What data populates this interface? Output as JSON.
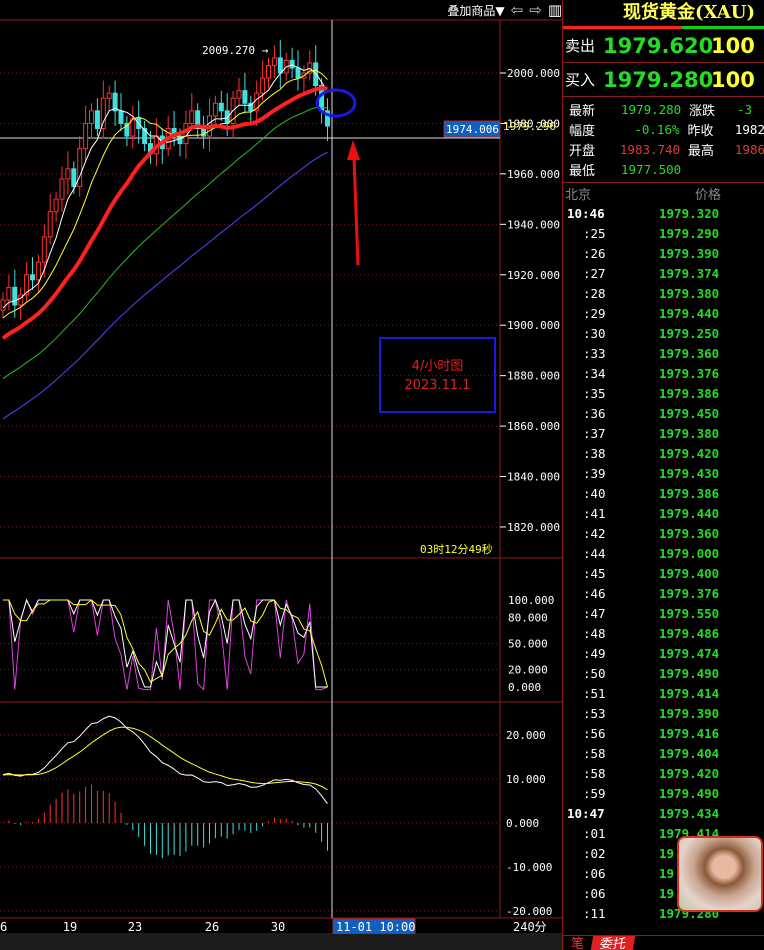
{
  "toolbar": {
    "overlay_label": "叠加商品▼",
    "prev_icon": "⇦",
    "next_icon": "⇨",
    "layout_icon": "▥"
  },
  "instrument": {
    "title": "现货黄金(XAU)"
  },
  "quotes": {
    "sell": {
      "label": "卖出",
      "price": "1979.620",
      "volume": "100"
    },
    "buy": {
      "label": "买入",
      "price": "1979.280",
      "volume": "100"
    }
  },
  "stats": [
    {
      "k": "最新",
      "v": "1979.280",
      "vc": "g1",
      "k2": "涨跌",
      "v2": "-3",
      "v2c": "g1"
    },
    {
      "k": "幅度",
      "v": "-0.16%",
      "vc": "g1",
      "k2": "昨收",
      "v2": "1982",
      "v2c": "wh"
    },
    {
      "k": "开盘",
      "v": "1983.740",
      "vc": "red",
      "k2": "最高",
      "v2": "1986",
      "v2c": "red"
    },
    {
      "k": "最低",
      "v": "1977.500",
      "vc": "g1",
      "k2": "",
      "v2": "",
      "v2c": "wh"
    }
  ],
  "ticks_header": {
    "time": "北京",
    "price": "价格"
  },
  "ticks": [
    {
      "t": "10:46",
      "p": "1979.320",
      "bold": true
    },
    {
      "t": ":25",
      "p": "1979.290"
    },
    {
      "t": ":26",
      "p": "1979.390"
    },
    {
      "t": ":27",
      "p": "1979.374"
    },
    {
      "t": ":28",
      "p": "1979.380"
    },
    {
      "t": ":29",
      "p": "1979.440"
    },
    {
      "t": ":30",
      "p": "1979.250"
    },
    {
      "t": ":33",
      "p": "1979.360"
    },
    {
      "t": ":34",
      "p": "1979.376"
    },
    {
      "t": ":35",
      "p": "1979.386"
    },
    {
      "t": ":36",
      "p": "1979.450"
    },
    {
      "t": ":37",
      "p": "1979.380"
    },
    {
      "t": ":38",
      "p": "1979.420"
    },
    {
      "t": ":39",
      "p": "1979.430"
    },
    {
      "t": ":40",
      "p": "1979.386"
    },
    {
      "t": ":41",
      "p": "1979.440"
    },
    {
      "t": ":42",
      "p": "1979.360"
    },
    {
      "t": ":44",
      "p": "1979.000"
    },
    {
      "t": ":45",
      "p": "1979.400"
    },
    {
      "t": ":46",
      "p": "1979.376"
    },
    {
      "t": ":47",
      "p": "1979.550"
    },
    {
      "t": ":48",
      "p": "1979.486"
    },
    {
      "t": ":49",
      "p": "1979.474"
    },
    {
      "t": ":50",
      "p": "1979.490"
    },
    {
      "t": ":51",
      "p": "1979.414"
    },
    {
      "t": ":53",
      "p": "1979.390"
    },
    {
      "t": ":56",
      "p": "1979.416"
    },
    {
      "t": ":58",
      "p": "1979.404"
    },
    {
      "t": ":58",
      "p": "1979.420"
    },
    {
      "t": ":59",
      "p": "1979.490"
    },
    {
      "t": "10:47",
      "p": "1979.434",
      "bold": true
    },
    {
      "t": ":01",
      "p": "1979.414"
    },
    {
      "t": ":02",
      "p": "19"
    },
    {
      "t": ":06",
      "p": "19"
    },
    {
      "t": ":06",
      "p": "19"
    },
    {
      "t": ":11",
      "p": "1979.280"
    }
  ],
  "bottom_tabs": [
    "笔",
    "委托"
  ],
  "annotation": {
    "line1": "4/小时图",
    "line2": "2023.11.1"
  },
  "colors": {
    "up": "#ff3030",
    "down": "#40e0e0",
    "accent": "#1060c0",
    "frame": "#8b1a1a"
  },
  "chart_data": {
    "type": "candlestick",
    "price_axis": {
      "ticks": [
        "2000.000",
        "1980.000",
        "1960.000",
        "1940.000",
        "1920.000",
        "1900.000",
        "1880.000",
        "1860.000",
        "1840.000",
        "1820.000"
      ],
      "values": [
        2000,
        1980,
        1960,
        1940,
        1920,
        1900,
        1880,
        1860,
        1840,
        1820
      ],
      "current": "1979.290",
      "crosshair": "1974.006"
    },
    "high_label": "2009.270 →",
    "countdown": "03时12分49秒",
    "stoch_axis": {
      "ticks": [
        "100.000",
        "80.000",
        "50.000",
        "20.000",
        "0.000"
      ],
      "values": [
        100,
        80,
        50,
        20,
        0
      ]
    },
    "macd_axis": {
      "ticks": [
        "20.000",
        "10.000",
        "0.000",
        "-10.000",
        "-20.000"
      ],
      "values": [
        20,
        10,
        0,
        -10,
        -20
      ]
    },
    "x_labels": [
      "6",
      "19",
      "23",
      "26",
      "30"
    ],
    "cursor_time": "11-01 10:00",
    "period": "240分",
    "closes": [
      1910,
      1915,
      1908,
      1912,
      1920,
      1918,
      1925,
      1935,
      1945,
      1950,
      1958,
      1962,
      1955,
      1970,
      1980,
      1985,
      1978,
      1990,
      1992,
      1985,
      1980,
      1975,
      1982,
      1978,
      1972,
      1968,
      1975,
      1970,
      1978,
      1975,
      1972,
      1980,
      1985,
      1978,
      1975,
      1983,
      1988,
      1985,
      1980,
      1990,
      1993,
      1988,
      1985,
      1992,
      1998,
      2003,
      2006,
      2000,
      2005,
      2002,
      1998,
      2000,
      2004,
      1995,
      1985,
      1979
    ]
  }
}
